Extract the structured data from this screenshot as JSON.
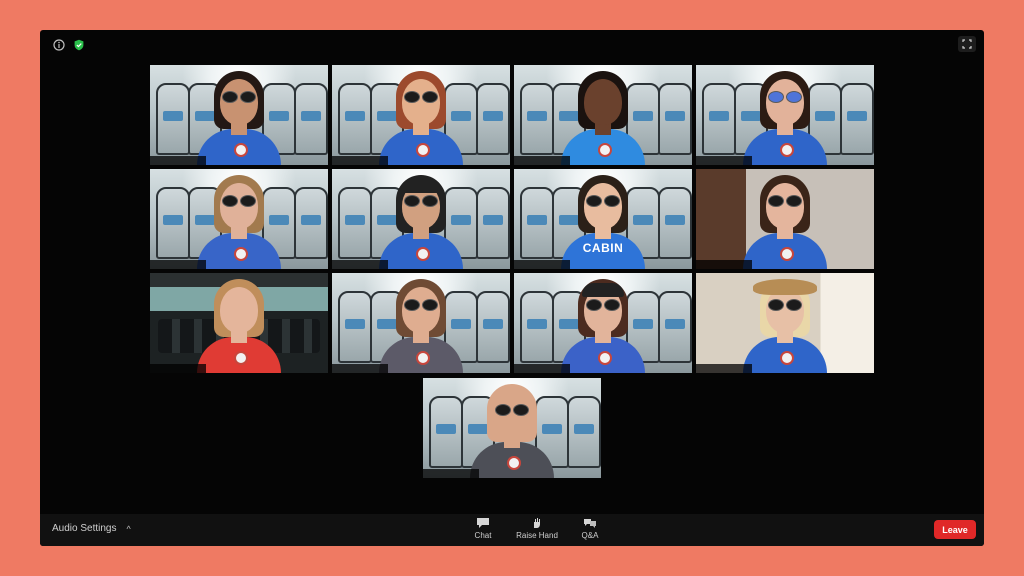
{
  "meeting": {
    "participants": [
      {
        "background": "cabin",
        "shirt": "#2f65c9",
        "skin": "#c89271",
        "hair": "#231814",
        "glasses": "dark",
        "active": false
      },
      {
        "background": "cabin",
        "shirt": "#2f65c9",
        "skin": "#e4b08c",
        "hair": "#9c4a2d",
        "glasses": "dark",
        "active": false
      },
      {
        "background": "cabin",
        "shirt": "#2f8be0",
        "skin": "#6a412d",
        "hair": "#1a120f",
        "glasses": "none",
        "active": false
      },
      {
        "background": "cabin",
        "shirt": "#2f65c9",
        "skin": "#e2b29a",
        "hair": "#2c1b13",
        "glasses": "blue",
        "active": false
      },
      {
        "background": "cabin",
        "shirt": "#3865c8",
        "skin": "#e0b199",
        "hair": "#a27a4e",
        "glasses": "dark",
        "active": false
      },
      {
        "background": "cabin",
        "shirt": "#2f65c9",
        "skin": "#d1a080",
        "hair": "#222222",
        "glasses": "dark",
        "active": true,
        "cap": "black"
      },
      {
        "background": "cabin",
        "shirt": "#2e74d8",
        "skin": "#e8bc9f",
        "hair": "#2b2018",
        "glasses": "dark",
        "active": false,
        "shirt_text": "CABIN"
      },
      {
        "background": "room",
        "shirt": "#2f65c9",
        "skin": "#e4b59d",
        "hair": "#3a2418",
        "glasses": "dark",
        "active": false
      },
      {
        "background": "cockpit",
        "shirt": "#e03b34",
        "skin": "#e4b59b",
        "hair": "#c08e5b",
        "glasses": "none",
        "active": false
      },
      {
        "background": "cabin",
        "shirt": "#5c5a68",
        "skin": "#dfad90",
        "hair": "#6f4b34",
        "glasses": "dark",
        "active": false
      },
      {
        "background": "cabin",
        "shirt": "#3b62c8",
        "skin": "#e2b49b",
        "hair": "#4c2b1f",
        "glasses": "dark",
        "active": false,
        "cap": "black"
      },
      {
        "background": "room2",
        "shirt": "#2f65c9",
        "skin": "#e7c0a6",
        "hair": "#e9d7a8",
        "glasses": "dark",
        "active": false,
        "hat": "straw"
      },
      {
        "background": "cabin",
        "shirt": "#4d4f57",
        "skin": "#d9a688",
        "hair": "#d9a688",
        "glasses": "dark",
        "active": false
      }
    ]
  },
  "controls": {
    "audio_settings": "Audio Settings",
    "chat": "Chat",
    "raise_hand": "Raise Hand",
    "qa": "Q&A",
    "leave": "Leave"
  }
}
